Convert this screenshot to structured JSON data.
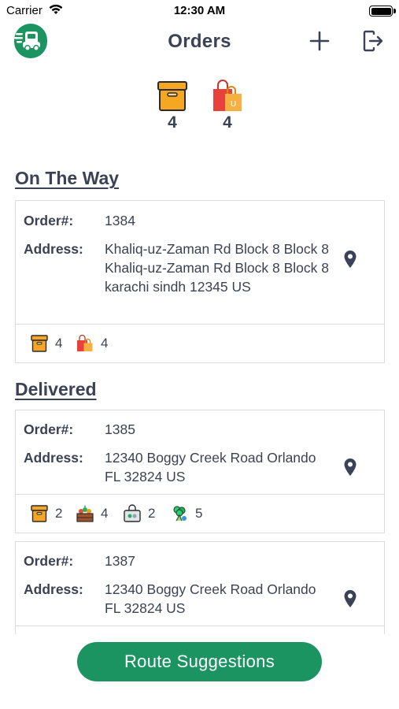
{
  "status_bar": {
    "carrier": "Carrier",
    "time": "12:30 AM"
  },
  "nav": {
    "title": "Orders"
  },
  "summary": {
    "boxes_count": "4",
    "bags_count": "4"
  },
  "sections": [
    {
      "title": "On The Way",
      "orders": [
        {
          "order_label": "Order#:",
          "order_no": "1384",
          "address_label": "Address:",
          "address": "Khaliq-uz-Zaman Rd Block 8 Block 8 Khaliq-uz-Zaman Rd Block 8 Block 8 karachi sindh 12345 US",
          "items": [
            {
              "icon": "box-icon",
              "qty": "4"
            },
            {
              "icon": "bag-icon",
              "qty": "4"
            }
          ]
        }
      ]
    },
    {
      "title": "Delivered",
      "orders": [
        {
          "order_label": "Order#:",
          "order_no": "1385",
          "address_label": "Address:",
          "address": "12340 Boggy Creek Road Orlando FL 32824 US",
          "items": [
            {
              "icon": "box-icon",
              "qty": "2"
            },
            {
              "icon": "produce-crate-icon",
              "qty": "4"
            },
            {
              "icon": "grocery-basket-icon",
              "qty": "2"
            },
            {
              "icon": "broccoli-icon",
              "qty": "5"
            }
          ]
        },
        {
          "order_label": "Order#:",
          "order_no": "1387",
          "address_label": "Address:",
          "address": "12340 Boggy Creek Road Orlando FL 32824 US",
          "items": []
        }
      ]
    }
  ],
  "route_button": {
    "label": "Route Suggestions"
  },
  "colors": {
    "brand_green": "#1c9462",
    "text": "#3b4255",
    "border": "#d9dbe0",
    "box_orange": "#f5a623",
    "bag_red": "#e8413b"
  }
}
